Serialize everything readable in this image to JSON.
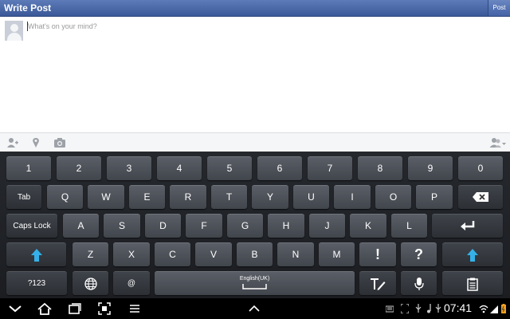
{
  "header": {
    "title": "Write Post",
    "post_label": "Post"
  },
  "composer": {
    "placeholder": "What's on your mind?"
  },
  "keyboard": {
    "row1": [
      "1",
      "2",
      "3",
      "4",
      "5",
      "6",
      "7",
      "8",
      "9",
      "0"
    ],
    "tab_label": "Tab",
    "row2": [
      "Q",
      "W",
      "E",
      "R",
      "T",
      "Y",
      "U",
      "I",
      "O",
      "P"
    ],
    "caps_label": "Caps Lock",
    "row3": [
      "A",
      "S",
      "D",
      "F",
      "G",
      "H",
      "J",
      "K",
      "L"
    ],
    "row4": [
      "Z",
      "X",
      "C",
      "V",
      "B",
      "N",
      "M"
    ],
    "exclaim": "!",
    "question": "?",
    "sym_label": "?123",
    "at_label": "@",
    "space_label": "English(UK)"
  },
  "status": {
    "time": "07:41"
  },
  "colors": {
    "header": "#3b5998",
    "keyboard_bg": "#1f2226",
    "key": "#4b4f56",
    "accent_arrow": "#35b0e8"
  },
  "icons": {
    "tag": "tag-friends-icon",
    "location": "location-pin-icon",
    "camera": "camera-icon",
    "audience": "audience-icon",
    "backspace": "backspace-icon",
    "enter": "enter-icon",
    "shift": "shift-arrow-icon",
    "globe": "globe-icon",
    "handwriting": "handwriting-icon",
    "mic": "microphone-icon",
    "clipboard": "clipboard-icon"
  }
}
